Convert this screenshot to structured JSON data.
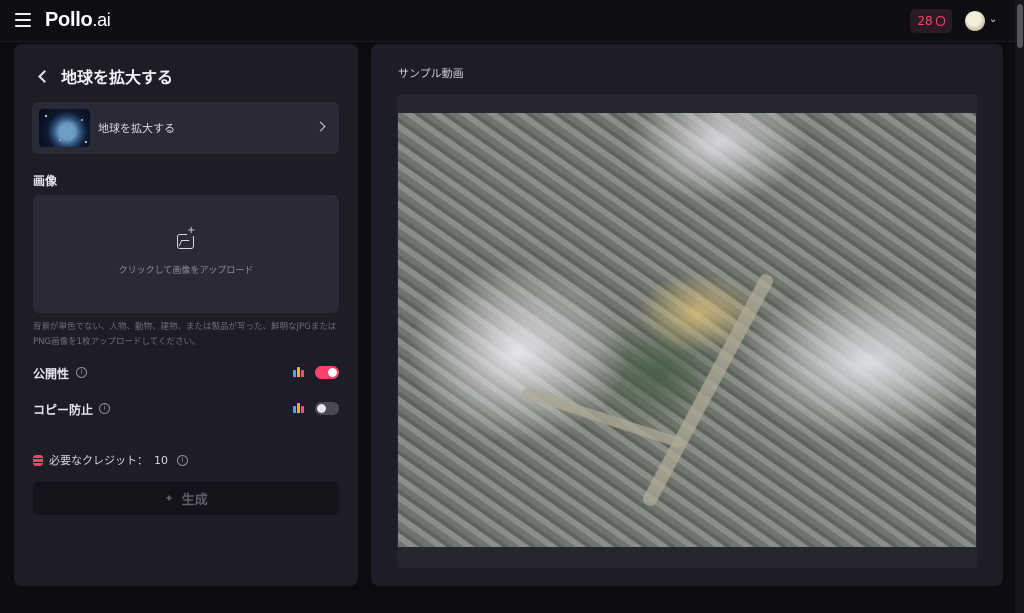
{
  "header": {
    "logo_main": "Pollo",
    "logo_sub": ".ai",
    "credits": "28"
  },
  "left": {
    "title": "地球を拡大する",
    "template_label": "地球を拡大する",
    "image_section": "画像",
    "upload_text": "クリックして画像をアップロード",
    "hint": "背景が単色でない、人物、動物、建物、または製品が写った、鮮明なJPGまたはPNG画像を1枚アップロードしてください。",
    "public_label": "公開性",
    "public_on": true,
    "copy_label": "コピー防止",
    "copy_on": false,
    "credit_label": "必要なクレジット：",
    "credit_value": "10",
    "generate_label": "生成"
  },
  "right": {
    "sample_label": "サンプル動画"
  }
}
